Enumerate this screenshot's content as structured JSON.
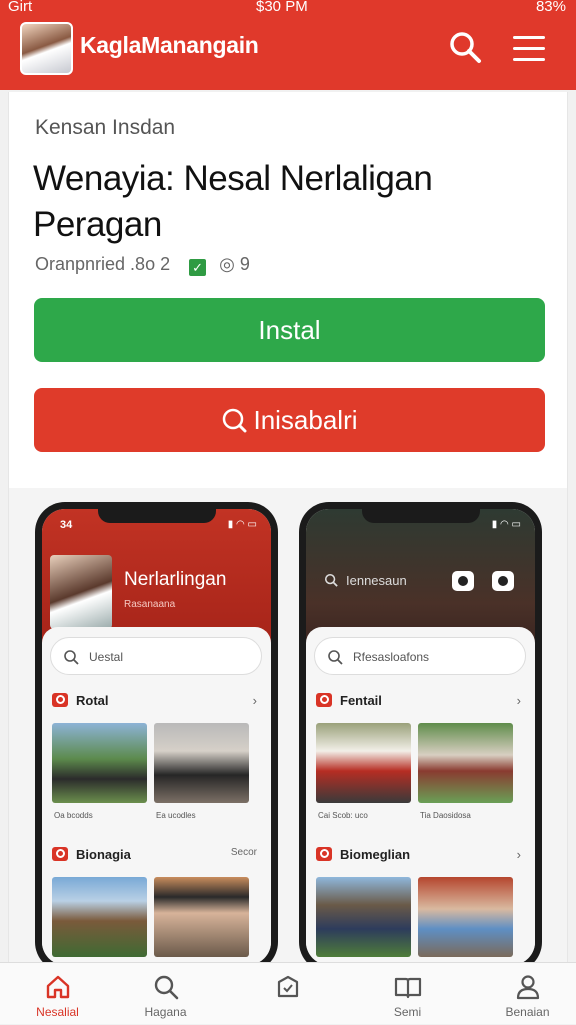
{
  "status": {
    "left": "Girt",
    "time": "$30 PM",
    "battery": "83%"
  },
  "app": {
    "name": "KaglaManangain"
  },
  "listing": {
    "category": "Kensan Insdan",
    "title": "Wenayia: Nesal Nerlaligan Peragan",
    "meta": "Oranpnried .8o 2",
    "meta_count": "9"
  },
  "buttons": {
    "install": "Instal",
    "second": "Inisabalri"
  },
  "phone1": {
    "time": "34",
    "title": "Nerlarlingan",
    "subtitle": "Rasanaana",
    "search": "Uestal",
    "section1": "Rotal",
    "section2": "Bionagia",
    "section2_extra": "Secor",
    "captions": [
      "Oa bcodds",
      "Ea ucodles"
    ]
  },
  "phone2": {
    "search_top": "Iennesaun",
    "search": "Rfesasloafons",
    "section1": "Fentail",
    "section2": "Biomeglian",
    "captions": [
      "Cai Scob: uco",
      "Tia Daosidosa"
    ]
  },
  "nav": [
    {
      "label": "Nesalial",
      "icon": "home-icon"
    },
    {
      "label": "Hagana",
      "icon": "search-icon"
    },
    {
      "label": "",
      "icon": "tag-icon"
    },
    {
      "label": "Semi",
      "icon": "book-icon"
    },
    {
      "label": "Benaian",
      "icon": "profile-icon"
    }
  ]
}
